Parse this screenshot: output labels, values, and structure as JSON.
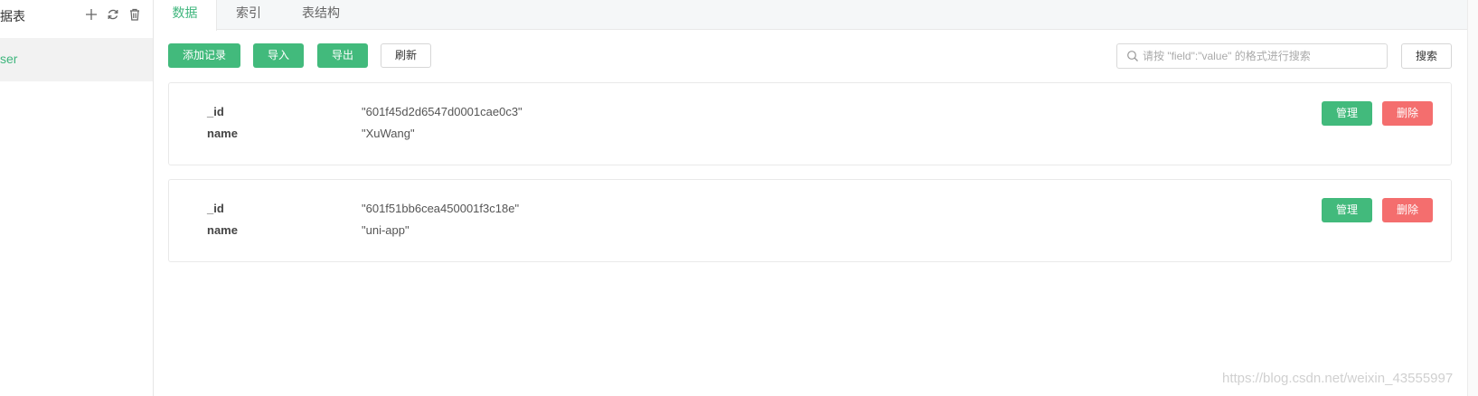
{
  "sidebar": {
    "title": "据表",
    "actions": [
      {
        "icon": "plus-icon"
      },
      {
        "icon": "refresh-icon"
      },
      {
        "icon": "trash-icon"
      }
    ],
    "items": [
      {
        "label": "ser",
        "selected": true
      }
    ]
  },
  "tabs": [
    {
      "label": "数据",
      "active": true
    },
    {
      "label": "索引",
      "active": false
    },
    {
      "label": "表结构",
      "active": false
    }
  ],
  "toolbar": {
    "add_label": "添加记录",
    "import_label": "导入",
    "export_label": "导出",
    "refresh_label": "刷新"
  },
  "search": {
    "placeholder": "请按 \"field\":\"value\" 的格式进行搜索",
    "value": "",
    "button_label": "搜索"
  },
  "records": [
    {
      "fields": [
        {
          "key": "_id",
          "value": "\"601f45d2d6547d0001cae0c3\""
        },
        {
          "key": "name",
          "value": "\"XuWang\""
        }
      ],
      "manage_label": "管理",
      "delete_label": "删除"
    },
    {
      "fields": [
        {
          "key": "_id",
          "value": "\"601f51bb6cea450001f3c18e\""
        },
        {
          "key": "name",
          "value": "\"uni-app\""
        }
      ],
      "manage_label": "管理",
      "delete_label": "删除"
    }
  ],
  "watermark": "https://blog.csdn.net/weixin_43555997",
  "colors": {
    "accent": "#42ba7c",
    "danger": "#f46e6e",
    "selected_bg": "#f2f2f2"
  }
}
